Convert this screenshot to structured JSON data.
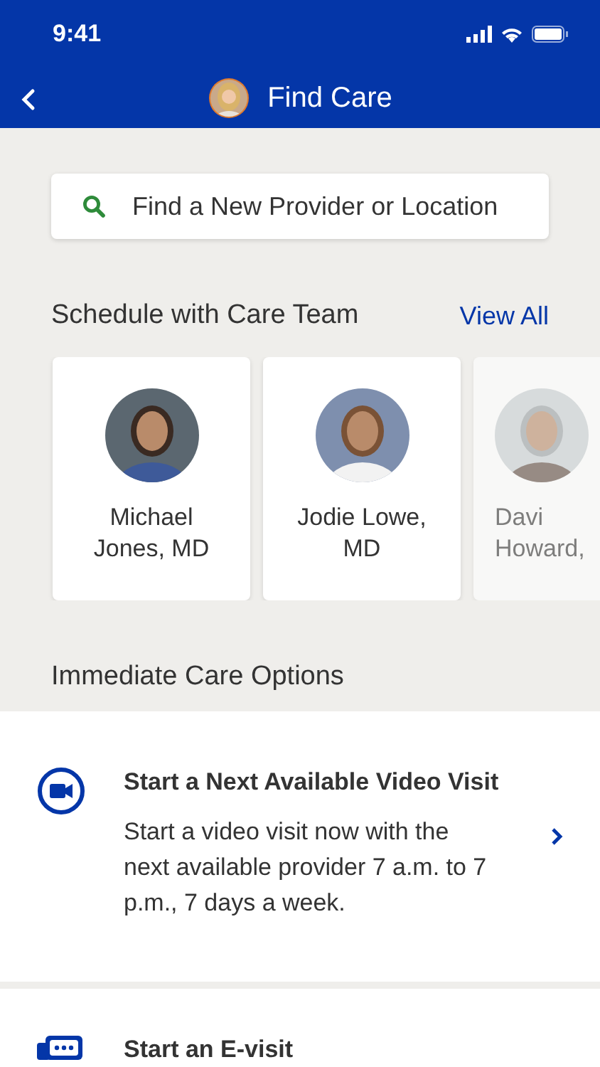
{
  "status_bar": {
    "time": "9:41"
  },
  "header": {
    "title": "Find Care"
  },
  "search": {
    "placeholder": "Find a New Provider or Location"
  },
  "care_team": {
    "heading": "Schedule with Care Team",
    "link": "View All",
    "providers": [
      {
        "name_lines": [
          "Michael",
          "Jones, MD"
        ],
        "partial": false
      },
      {
        "name_lines": [
          "Jodie Lowe,",
          "MD"
        ],
        "partial": false
      },
      {
        "name_lines": [
          "Davi",
          "Howard,"
        ],
        "partial": true
      }
    ]
  },
  "immediate": {
    "heading": "Immediate Care Options",
    "options": [
      {
        "kind": "video",
        "title": "Start a Next Available Video Visit",
        "description": "Start a video visit now with the next available provider 7 a.m. to 7 p.m., 7 days a week."
      },
      {
        "kind": "evisit",
        "title": "Start an E-visit"
      }
    ]
  }
}
